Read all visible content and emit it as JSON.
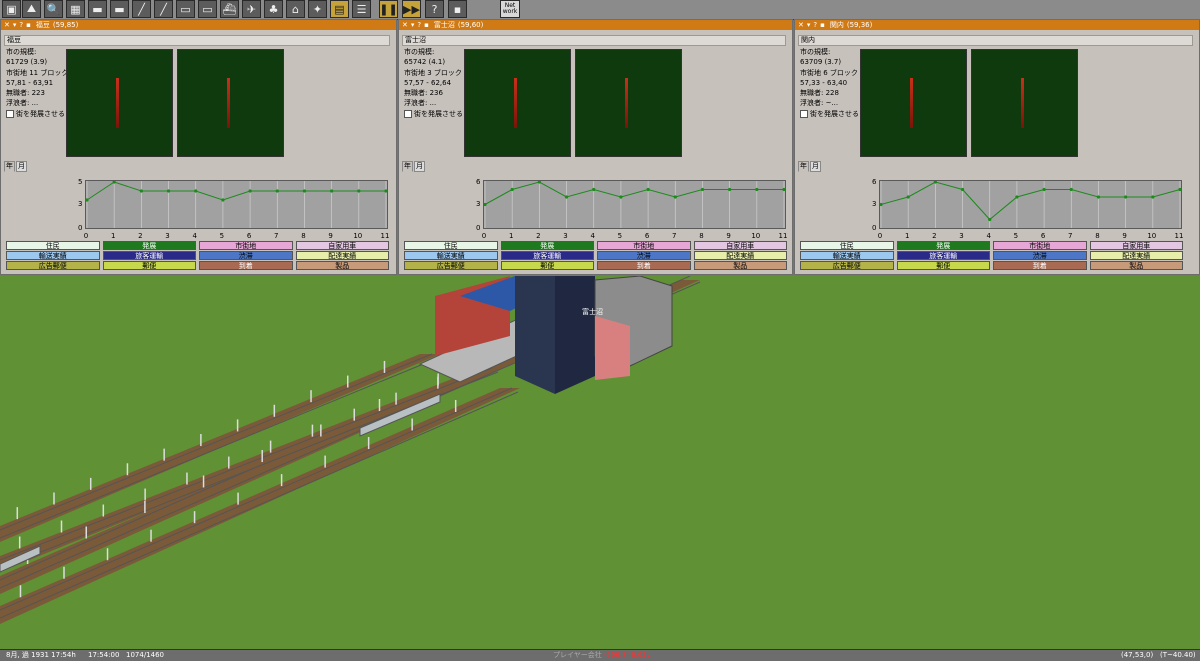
{
  "toolbar": {
    "icons": [
      "save-icon",
      "terrain-icon",
      "inspect-icon",
      "landscape-icon",
      "train-icon",
      "engine-icon",
      "rail-icon",
      "road-icon",
      "bus-icon",
      "tram-icon",
      "ship-icon",
      "air-icon",
      "tree-icon",
      "station-icon",
      "special-icon",
      "finance-icon",
      "list-icon",
      "pause-icon",
      "fastforward-icon",
      "help-icon",
      "inactive-icon",
      "network-icon"
    ],
    "network_label": "Net work"
  },
  "windows": [
    {
      "title": "福豆",
      "coords": "(59,85)",
      "name": "福豆",
      "population": "61729 (3.9)",
      "city_blocks": "市街地 11 ブロック",
      "range": "57,81 - 63,91",
      "unemployed": "無職者: 223",
      "homeless": "浮浪者: ...",
      "grow_label": "街を発展させる",
      "tabs": [
        "年",
        "月"
      ],
      "values": [
        3,
        5,
        4,
        4,
        4,
        3,
        4,
        4,
        4,
        4,
        4,
        4
      ]
    },
    {
      "title": "富士沼",
      "coords": "(59,60)",
      "name": "富士沼",
      "population": "65742 (4.1)",
      "city_blocks": "市街地 3 ブロック",
      "range": "57,57 - 62,64",
      "unemployed": "無職者: 236",
      "homeless": "浮浪者: ...",
      "grow_label": "街を発展させる",
      "tabs": [
        "年",
        "月"
      ],
      "values": [
        3,
        5,
        6,
        4,
        5,
        4,
        5,
        4,
        5,
        5,
        5,
        5
      ]
    },
    {
      "title": "関内",
      "coords": "(59,36)",
      "name": "関内",
      "population": "63709 (3.7)",
      "city_blocks": "市街地 6 ブロック",
      "range": "57,33 - 63,40",
      "unemployed": "無職者: 228",
      "homeless": "浮浪者: ~...",
      "grow_label": "街を発展させる",
      "tabs": [
        "年",
        "月"
      ],
      "values": [
        3,
        4,
        6,
        5,
        1,
        4,
        5,
        5,
        4,
        4,
        4,
        5
      ]
    }
  ],
  "chart": {
    "type": "line",
    "x": [
      0,
      1,
      2,
      3,
      4,
      5,
      6,
      7,
      8,
      9,
      10,
      11
    ],
    "ylim_labels": [
      "5",
      "3",
      "0"
    ],
    "ylim_labels_alt": [
      "6",
      "3",
      "0"
    ],
    "series_color": "#1d8a1d"
  },
  "legend": [
    {
      "label": "住民",
      "color": "#e8f6e8"
    },
    {
      "label": "発展",
      "color": "#1f7a1f",
      "text": "#ffffff"
    },
    {
      "label": "市街地",
      "color": "#e6a6d6"
    },
    {
      "label": "自家用車",
      "color": "#e2c6e2"
    },
    {
      "label": "輸送実績",
      "color": "#9cc7ef"
    },
    {
      "label": "旅客運輸",
      "color": "#2a2a88",
      "text": "#ffffff"
    },
    {
      "label": "渋滞",
      "color": "#4d77c6"
    },
    {
      "label": "配達実績",
      "color": "#e7eeaa"
    },
    {
      "label": "広告郵便",
      "color": "#b3b34a"
    },
    {
      "label": "郵便",
      "color": "#c7d84d"
    },
    {
      "label": "到着",
      "color": "#a86a53",
      "text": "#ffffff"
    },
    {
      "label": "製品",
      "color": "#c79a7a"
    }
  ],
  "city_label": "富士沼",
  "status": {
    "date": "8月, 過 1931 17:54h",
    "time": "17:54:00",
    "speed": "1074/1460",
    "company": "プレイヤー会社",
    "money": "-506,846.62¢",
    "coords": "(47,53,0)",
    "zoom": "(T~40.40)"
  }
}
